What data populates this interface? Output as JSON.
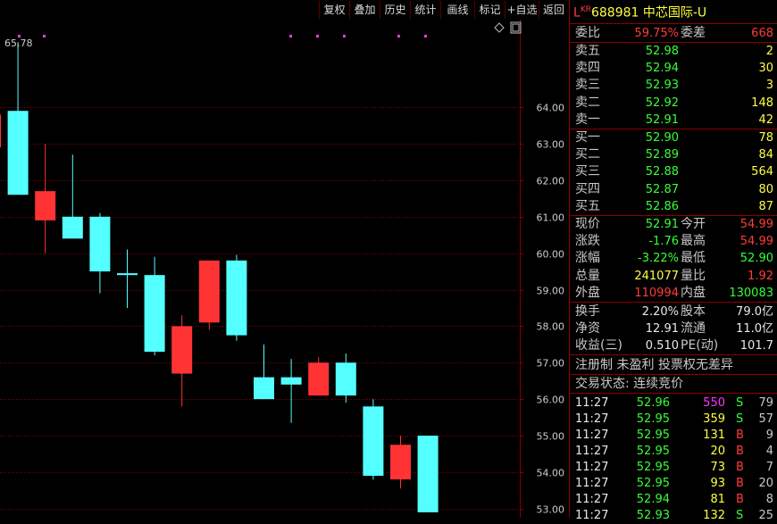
{
  "toolbar": {
    "buttons": [
      "复权",
      "叠加",
      "历史",
      "统计",
      "画线",
      "标记",
      "+自选",
      "返回"
    ]
  },
  "chart_data": {
    "type": "candlestick",
    "title": "",
    "max_label": "65.78",
    "ylim": [
      52.75,
      66.4
    ],
    "y_ticks": [
      "64.00",
      "63.00",
      "62.00",
      "61.00",
      "60.00",
      "59.00",
      "58.00",
      "57.00",
      "56.00",
      "55.00",
      "54.00",
      "53.00"
    ],
    "candles": [
      {
        "open": 62.9,
        "close": 63.8,
        "high": 64.0,
        "low": 62.7,
        "dir": "up"
      },
      {
        "open": 63.9,
        "close": 61.6,
        "high": 65.78,
        "low": 61.6,
        "dir": "down"
      },
      {
        "open": 60.9,
        "close": 61.7,
        "high": 63.0,
        "low": 60.0,
        "dir": "up"
      },
      {
        "open": 61.0,
        "close": 60.4,
        "high": 62.7,
        "low": 60.4,
        "dir": "down"
      },
      {
        "open": 61.0,
        "close": 59.5,
        "high": 61.1,
        "low": 58.9,
        "dir": "down"
      },
      {
        "open": 59.45,
        "close": 59.4,
        "high": 60.1,
        "low": 58.5,
        "dir": "down"
      },
      {
        "open": 59.4,
        "close": 57.3,
        "high": 59.9,
        "low": 57.2,
        "dir": "down"
      },
      {
        "open": 56.7,
        "close": 58.0,
        "high": 58.3,
        "low": 55.8,
        "dir": "up"
      },
      {
        "open": 58.1,
        "close": 59.8,
        "high": 59.8,
        "low": 57.9,
        "dir": "up"
      },
      {
        "open": 59.8,
        "close": 57.75,
        "high": 59.95,
        "low": 57.6,
        "dir": "down"
      },
      {
        "open": 56.6,
        "close": 56.0,
        "high": 57.5,
        "low": 56.0,
        "dir": "down"
      },
      {
        "open": 56.6,
        "close": 56.4,
        "high": 57.1,
        "low": 55.35,
        "dir": "down"
      },
      {
        "open": 56.1,
        "close": 57.0,
        "high": 57.15,
        "low": 56.1,
        "dir": "up"
      },
      {
        "open": 57.0,
        "close": 56.1,
        "high": 57.25,
        "low": 55.9,
        "dir": "down"
      },
      {
        "open": 55.8,
        "close": 53.9,
        "high": 56.0,
        "low": 53.8,
        "dir": "down"
      },
      {
        "open": 53.8,
        "close": 54.75,
        "high": 55.0,
        "low": 53.55,
        "dir": "up"
      },
      {
        "open": 55.0,
        "close": 52.9,
        "high": 55.0,
        "low": 52.9,
        "dir": "down"
      }
    ],
    "colors": {
      "up": "#ff3333",
      "down": "#54ffff",
      "grid": "#8a0000",
      "axis_text": "#cccccc"
    }
  },
  "stock": {
    "prefix": "L",
    "market": "KR",
    "code": "688981",
    "name": "中芯国际-U"
  },
  "order_ratio": {
    "label1": "委比",
    "value1": "59.75%",
    "label2": "委差",
    "value2": "668"
  },
  "asks": [
    {
      "label": "卖五",
      "price": "52.98",
      "vol": "2"
    },
    {
      "label": "卖四",
      "price": "52.94",
      "vol": "30"
    },
    {
      "label": "卖三",
      "price": "52.93",
      "vol": "3"
    },
    {
      "label": "卖二",
      "price": "52.92",
      "vol": "148"
    },
    {
      "label": "卖一",
      "price": "52.91",
      "vol": "42"
    }
  ],
  "bids": [
    {
      "label": "买一",
      "price": "52.90",
      "vol": "78"
    },
    {
      "label": "买二",
      "price": "52.89",
      "vol": "84"
    },
    {
      "label": "买三",
      "price": "52.88",
      "vol": "564"
    },
    {
      "label": "买四",
      "price": "52.87",
      "vol": "80"
    },
    {
      "label": "买五",
      "price": "52.86",
      "vol": "87"
    }
  ],
  "quote": [
    {
      "l1": "现价",
      "v1": "52.91",
      "c1": "green",
      "l2": "今开",
      "v2": "54.99",
      "c2": "red"
    },
    {
      "l1": "涨跌",
      "v1": "-1.76",
      "c1": "green",
      "l2": "最高",
      "v2": "54.99",
      "c2": "red"
    },
    {
      "l1": "涨幅",
      "v1": "-3.22%",
      "c1": "green",
      "l2": "最低",
      "v2": "52.90",
      "c2": "green"
    },
    {
      "l1": "总量",
      "v1": "241077",
      "c1": "yellow",
      "l2": "量比",
      "v2": "1.92",
      "c2": "red"
    },
    {
      "l1": "外盘",
      "v1": "110994",
      "c1": "red",
      "l2": "内盘",
      "v2": "130083",
      "c2": "green"
    }
  ],
  "fundamentals": [
    {
      "l1": "换手",
      "v1": "2.20%",
      "l2": "股本",
      "v2": "79.0亿"
    },
    {
      "l1": "净资",
      "v1": "12.91",
      "l2": "流通",
      "v2": "11.0亿"
    },
    {
      "l1": "收益(三)",
      "v1": "0.510",
      "l2": "PE(动)",
      "v2": "101.7"
    }
  ],
  "notes": {
    "flags": "注册制 未盈利 投票权无差异",
    "status": "交易状态: 连续竞价"
  },
  "ticks": [
    {
      "time": "11:27",
      "price": "52.96",
      "vol": "550",
      "vcolor": "magenta",
      "side": "S",
      "scolor": "green",
      "n": "79"
    },
    {
      "time": "11:27",
      "price": "52.95",
      "vol": "359",
      "vcolor": "yellow",
      "side": "S",
      "scolor": "green",
      "n": "57"
    },
    {
      "time": "11:27",
      "price": "52.95",
      "vol": "131",
      "vcolor": "yellow",
      "side": "B",
      "scolor": "red",
      "n": "9"
    },
    {
      "time": "11:27",
      "price": "52.95",
      "vol": "20",
      "vcolor": "yellow",
      "side": "B",
      "scolor": "red",
      "n": "4"
    },
    {
      "time": "11:27",
      "price": "52.95",
      "vol": "73",
      "vcolor": "yellow",
      "side": "B",
      "scolor": "red",
      "n": "7"
    },
    {
      "time": "11:27",
      "price": "52.95",
      "vol": "93",
      "vcolor": "yellow",
      "side": "B",
      "scolor": "red",
      "n": "20"
    },
    {
      "time": "11:27",
      "price": "52.94",
      "vol": "81",
      "vcolor": "yellow",
      "side": "B",
      "scolor": "red",
      "n": "8"
    },
    {
      "time": "11:27",
      "price": "52.93",
      "vol": "132",
      "vcolor": "yellow",
      "side": "S",
      "scolor": "green",
      "n": "25"
    }
  ]
}
